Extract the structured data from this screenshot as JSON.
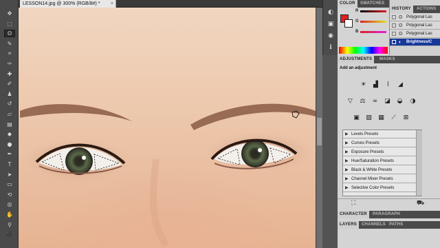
{
  "document": {
    "tab_title": "LESSON14.jpg @ 300% (RGB/8#) *",
    "close_glyph": "×"
  },
  "toolbar": {
    "tools": [
      {
        "name": "move-tool",
        "glyph": "✥"
      },
      {
        "name": "marquee-tool",
        "glyph": "⬚"
      },
      {
        "name": "lasso-tool",
        "glyph": "ʘ"
      },
      {
        "name": "quick-selection-tool",
        "glyph": "✎"
      },
      {
        "name": "crop-tool",
        "glyph": "⌗"
      },
      {
        "name": "eyedropper-tool",
        "glyph": "✑"
      },
      {
        "name": "healing-brush-tool",
        "glyph": "✚"
      },
      {
        "name": "brush-tool",
        "glyph": "✐"
      },
      {
        "name": "clone-stamp-tool",
        "glyph": "♟"
      },
      {
        "name": "history-brush-tool",
        "glyph": "↺"
      },
      {
        "name": "eraser-tool",
        "glyph": "▱"
      },
      {
        "name": "gradient-tool",
        "glyph": "▤"
      },
      {
        "name": "blur-tool",
        "glyph": "◆"
      },
      {
        "name": "dodge-tool",
        "glyph": "●"
      },
      {
        "name": "pen-tool",
        "glyph": "✒"
      },
      {
        "name": "type-tool",
        "glyph": "T"
      },
      {
        "name": "path-selection-tool",
        "glyph": "➤"
      },
      {
        "name": "shape-tool",
        "glyph": "▭"
      },
      {
        "name": "3d-rotate-tool",
        "glyph": "⟲"
      },
      {
        "name": "3d-orbit-tool",
        "glyph": "◎"
      },
      {
        "name": "hand-tool",
        "glyph": "✋"
      },
      {
        "name": "zoom-tool",
        "glyph": "⚲"
      },
      {
        "name": "default-colors",
        "glyph": "⬛"
      }
    ],
    "active_tool": "lasso-tool"
  },
  "panel_icons": [
    "◐",
    "▣",
    "◉",
    "ℹ"
  ],
  "color_panel": {
    "tabs": [
      "COLOR",
      "SWATCHES"
    ],
    "active_tab": "COLOR",
    "foreground_color": "#e02020",
    "background_color": "#ffffff",
    "channels": [
      {
        "label": "R",
        "color": "#e02020"
      },
      {
        "label": "G",
        "color": "#20a020"
      },
      {
        "label": "B",
        "color": "#2030e0"
      }
    ]
  },
  "history_panel": {
    "tabs": [
      "HISTORY",
      "ACTIONS"
    ],
    "active_tab": "HISTORY",
    "items": [
      {
        "label": "Polygonal Las",
        "selected": false
      },
      {
        "label": "Polygonal Las",
        "selected": false
      },
      {
        "label": "Polygonal Las",
        "selected": false
      },
      {
        "label": "Brightness/C",
        "selected": true
      }
    ]
  },
  "adjustments_panel": {
    "tabs": [
      "ADJUSTMENTS",
      "MASKS"
    ],
    "active_tab": "ADJUSTMENTS",
    "title": "Add an adjustment",
    "icon_row1": [
      "☀",
      "▟",
      "⌇",
      "◢"
    ],
    "icon_row2": [
      "▽",
      "⚖",
      "∞",
      "◪",
      "◒",
      "◑"
    ],
    "icon_row3": [
      "▣",
      "▨",
      "▦",
      "⟋",
      "⊠"
    ],
    "presets": [
      "Levels Presets",
      "Curves Presets",
      "Exposure Presets",
      "Hue/Saturation Presets",
      "Black & White Presets",
      "Channel Mixer Presets",
      "Selective Color Presets"
    ],
    "preset_arrow": "▶",
    "footer_icons": [
      "⛶",
      "⛟"
    ]
  },
  "character_panel": {
    "tabs": [
      "CHARACTER",
      "PARAGRAPH"
    ],
    "active_tab": "CHARACTER"
  },
  "layers_panel": {
    "tabs": [
      "LAYERS",
      "CHANNELS",
      "PATHS"
    ],
    "active_tab": "LAYERS"
  },
  "accent_colors": {
    "history_selection": "#16389a",
    "workspace": "#535353"
  }
}
